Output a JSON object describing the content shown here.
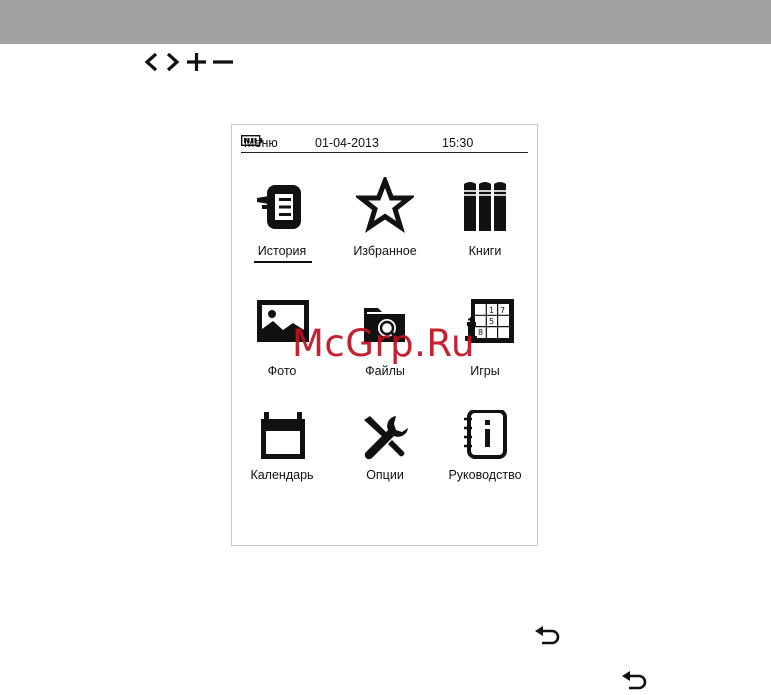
{
  "device_screen": {
    "status_bar": {
      "menu_label": "Меню",
      "date": "01-04-2013",
      "time": "15:30",
      "battery_icon": "battery-icon"
    },
    "tiles": [
      {
        "label": "История",
        "icon": "history-icon",
        "selected": true
      },
      {
        "label": "Избранное",
        "icon": "star-icon",
        "selected": false
      },
      {
        "label": "Книги",
        "icon": "books-icon",
        "selected": false
      },
      {
        "label": "Фото",
        "icon": "photo-icon",
        "selected": false
      },
      {
        "label": "Файлы",
        "icon": "files-icon",
        "selected": false
      },
      {
        "label": "Игры",
        "icon": "games-icon",
        "selected": false
      },
      {
        "label": "Календарь",
        "icon": "calendar-icon",
        "selected": false
      },
      {
        "label": "Опции",
        "icon": "options-icon",
        "selected": false
      },
      {
        "label": "Руководство",
        "icon": "manual-icon",
        "selected": false
      }
    ]
  },
  "nav_keys": [
    "chevron-left-icon",
    "chevron-right-icon",
    "plus-icon",
    "minus-icon"
  ],
  "return_icons": [
    "return-icon",
    "return-icon"
  ],
  "watermark": "McGrp.Ru",
  "colors": {
    "top_bar": "#a3a2a2",
    "watermark": "#c20f1f",
    "text": "#111111"
  }
}
